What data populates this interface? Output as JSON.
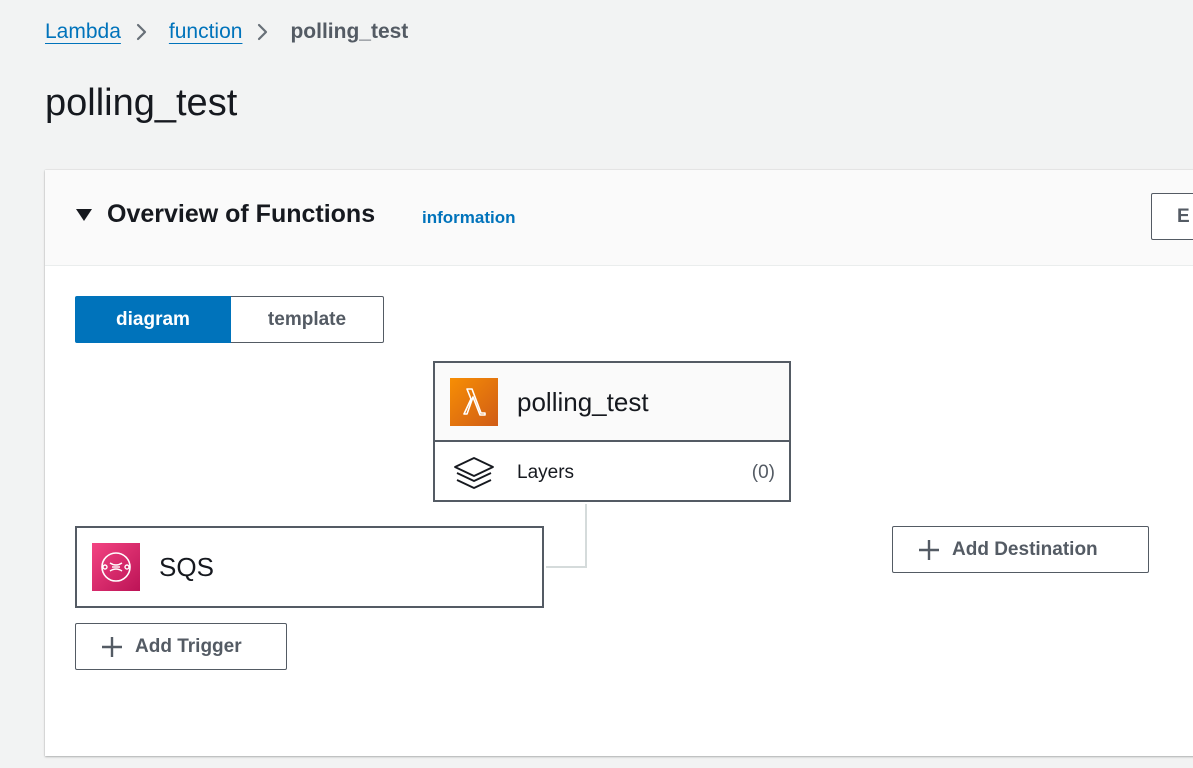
{
  "breadcrumb": {
    "items": [
      "Lambda",
      "function"
    ],
    "current": "polling_test"
  },
  "page": {
    "title": "polling_test"
  },
  "overview": {
    "title": "Overview of Functions",
    "info_label": "information",
    "edit_label": "E"
  },
  "view_toggle": {
    "diagram_label": "diagram",
    "template_label": "template",
    "selected": "diagram"
  },
  "function_node": {
    "name": "polling_test",
    "icon": "lambda-icon",
    "layers_label": "Layers",
    "layers_count": "(0)"
  },
  "trigger_node": {
    "name": "SQS",
    "icon": "sqs-icon"
  },
  "actions": {
    "add_trigger": "Add Trigger",
    "add_destination": "Add Destination"
  },
  "colors": {
    "accent": "#0073bb",
    "lambda_orange": "#e7711b",
    "sqs_pink": "#d91e63",
    "border": "#545b64",
    "background": "#f2f3f3"
  }
}
